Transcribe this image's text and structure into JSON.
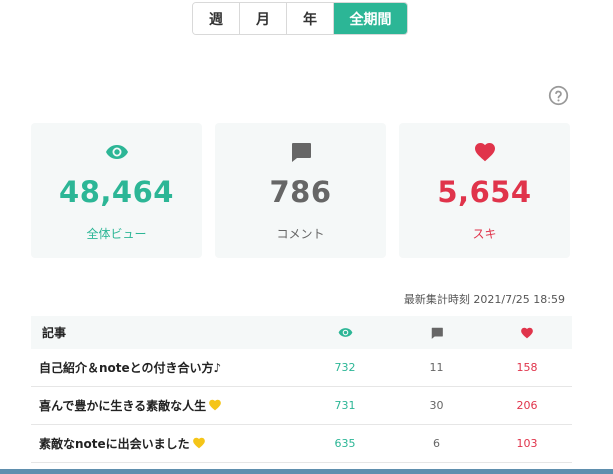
{
  "period_tabs": [
    {
      "label": "週",
      "active": false
    },
    {
      "label": "月",
      "active": false
    },
    {
      "label": "年",
      "active": false
    },
    {
      "label": "全期間",
      "active": true
    }
  ],
  "help_icon": "question-circle-icon",
  "stats": {
    "views": {
      "value": "48,464",
      "label": "全体ビュー",
      "icon": "eye-icon",
      "color": "#2cb696"
    },
    "comments": {
      "value": "786",
      "label": "コメント",
      "icon": "comment-icon",
      "color": "#666666"
    },
    "likes": {
      "value": "5,654",
      "label": "スキ",
      "icon": "heart-icon",
      "color": "#e0344b"
    }
  },
  "last_updated": "最新集計時刻 2021/7/25 18:59",
  "table": {
    "header_title": "記事",
    "rows": [
      {
        "title": "自己紹介＆noteとの付き合い方♪",
        "views": "732",
        "comments": "11",
        "likes": "158",
        "yellow_heart": false
      },
      {
        "title": "喜んで豊かに生きる素敵な人生",
        "views": "731",
        "comments": "30",
        "likes": "206",
        "yellow_heart": true
      },
      {
        "title": "素敵なnoteに出会いました",
        "views": "635",
        "comments": "6",
        "likes": "103",
        "yellow_heart": true
      }
    ]
  }
}
